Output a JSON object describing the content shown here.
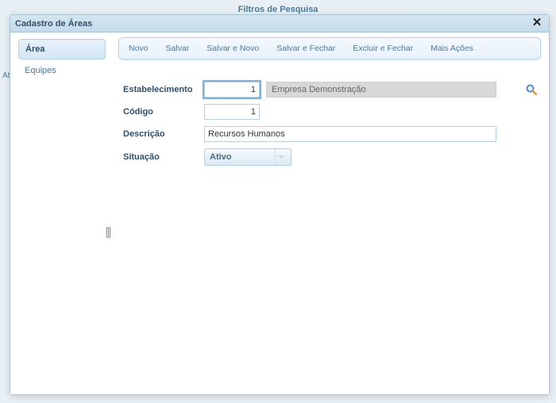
{
  "background": {
    "topTitle": "Filtros de Pesquisa",
    "sideLabel": "At"
  },
  "dialog": {
    "title": "Cadastro de Áreas"
  },
  "tabs": {
    "active": "Área",
    "items": [
      "Área",
      "Equipes"
    ]
  },
  "toolbar": {
    "novo": "Novo",
    "salvar": "Salvar",
    "salvarNovo": "Salvar e Novo",
    "salvarFechar": "Salvar e Fechar",
    "excluirFechar": "Excluir e Fechar",
    "maisAcoes": "Mais Ações"
  },
  "form": {
    "estabelecimento": {
      "label": "Estabelecimento",
      "value": "1",
      "display": "Empresa Demonstração"
    },
    "codigo": {
      "label": "Código",
      "value": "1"
    },
    "descricao": {
      "label": "Descrição",
      "value": "Recursos Humanos"
    },
    "situacao": {
      "label": "Situação",
      "value": "Ativo"
    }
  }
}
